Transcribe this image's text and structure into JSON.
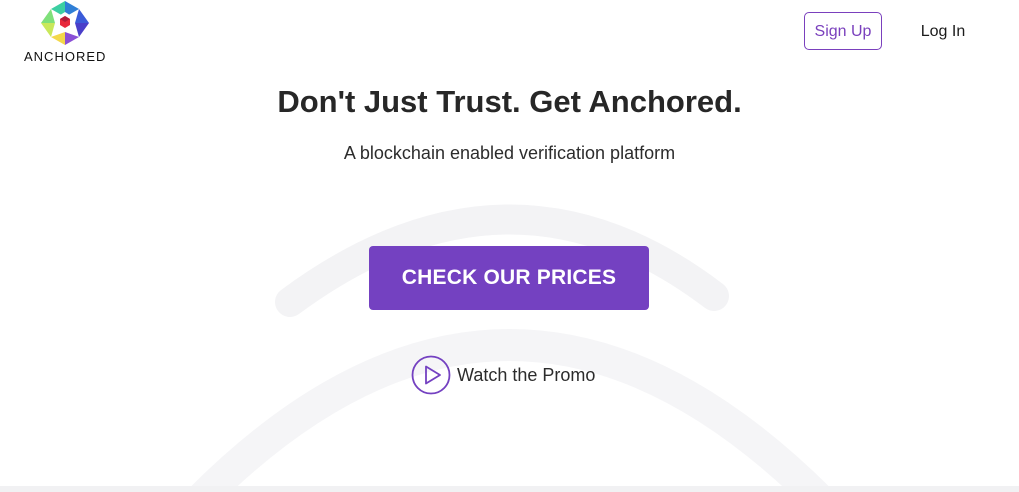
{
  "brand": {
    "name": "ANCHORED",
    "logo_icon": "hexagon-logo-icon"
  },
  "nav": {
    "signup_label": "Sign Up",
    "login_label": "Log In"
  },
  "hero": {
    "headline": "Don't Just Trust. Get Anchored.",
    "subheadline": "A blockchain enabled verification platform",
    "cta_label": "CHECK OUR PRICES",
    "promo_label": "Watch the Promo",
    "promo_icon": "play-icon"
  },
  "colors": {
    "accent": "#7441c1",
    "accent_border": "#7a40bd",
    "text": "#272727",
    "background": "#ffffff",
    "decor": "#f3f3f5"
  }
}
